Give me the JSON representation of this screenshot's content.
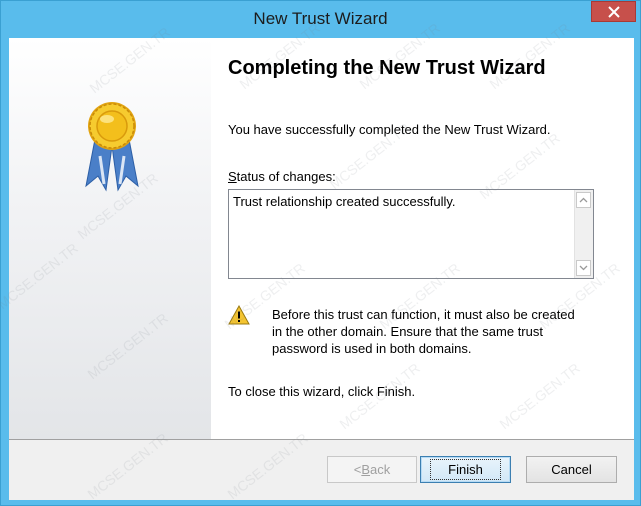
{
  "window": {
    "title": "New Trust Wizard"
  },
  "content": {
    "heading": "Completing the New Trust Wizard",
    "intro": "You have successfully completed the New Trust Wizard.",
    "status_label_mnemonic": "S",
    "status_label_rest": "tatus of changes:",
    "status_text": "Trust relationship created successfully.",
    "warning_lines": [
      "Before this trust can function, it must also be created",
      "in the other domain. Ensure that the same trust",
      "password is used in both domains."
    ],
    "close_note": "To close this wizard, click Finish."
  },
  "buttons": {
    "back_prefix": "< ",
    "back_mnemonic": "B",
    "back_rest": "ack",
    "finish": "Finish",
    "cancel": "Cancel"
  },
  "watermark": "MCSE.GEN.TR",
  "icons": {
    "close": "close-icon",
    "badge": "award-ribbon-icon",
    "warning": "warning-triangle-icon",
    "scroll_up": "chevron-up-icon",
    "scroll_down": "chevron-down-icon"
  },
  "colors": {
    "frame": "#59bcec",
    "close_button": "#c7504b",
    "warning": "#f4c430"
  }
}
